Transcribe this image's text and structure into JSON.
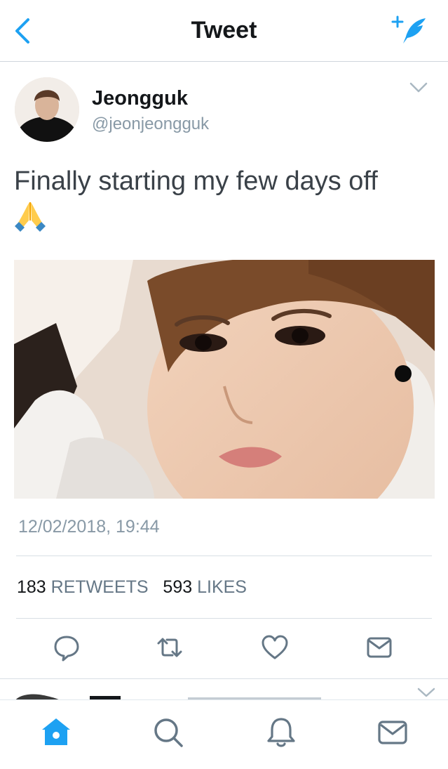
{
  "header": {
    "title": "Tweet",
    "back_icon": "chevron-left-icon",
    "compose_icon": "compose-tweet-icon"
  },
  "tweet": {
    "display_name": "Jeongguk",
    "handle": "@jeonjeongguk",
    "text": "Finally starting my few days off",
    "emoji": "🙏",
    "timestamp": "12/02/2018, 19:44",
    "retweets_count": "183",
    "retweets_label": "RETWEETS",
    "likes_count": "593",
    "likes_label": "LIKES"
  },
  "actions": [
    {
      "name": "reply-icon"
    },
    {
      "name": "retweet-icon"
    },
    {
      "name": "like-icon"
    },
    {
      "name": "direct-message-icon"
    }
  ],
  "tabbar": [
    {
      "name": "home-icon",
      "active": true
    },
    {
      "name": "search-icon",
      "active": false
    },
    {
      "name": "notifications-icon",
      "active": false
    },
    {
      "name": "messages-icon",
      "active": false
    }
  ],
  "colors": {
    "accent": "#1da1f2",
    "icon_gray": "#657786",
    "secondary_text": "#8899a6"
  }
}
